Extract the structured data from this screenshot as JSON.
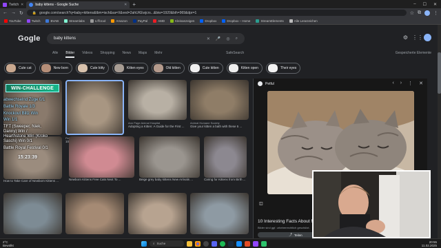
{
  "browser": {
    "tabs": [
      {
        "label": "Twitch",
        "favicon_color": "#9146ff",
        "active": false
      },
      {
        "label": "baby kittens - Google Suche",
        "favicon_color": "#4285f4",
        "active": true
      }
    ],
    "url": "google.com/search?q=baby+kittens&tbm=isch&sa=X&ved=2ahUKEwjcrs...&biw=1920&bih=969&dpr=1",
    "bookmarks": [
      {
        "label": "YouTube",
        "color": "#ff0000"
      },
      {
        "label": "Twitch",
        "color": "#9146ff"
      },
      {
        "label": "BVAB",
        "color": "#3c78d8"
      },
      {
        "label": "Streamlabs",
        "color": "#80f5d2"
      },
      {
        "label": "s.ffl.tool",
        "color": "#999999"
      },
      {
        "label": "Amazon",
        "color": "#ff9900"
      },
      {
        "label": "PayPal",
        "color": "#003087"
      },
      {
        "label": "AMD",
        "color": "#ed1c24"
      },
      {
        "label": "Kleinanzeigen",
        "color": "#86b817"
      },
      {
        "label": "Dropbox",
        "color": "#0061ff"
      },
      {
        "label": "Dropbox – Home",
        "color": "#0061ff"
      },
      {
        "label": "StreamElements",
        "color": "#2a9d8f"
      },
      {
        "label": "Alle Lesezeichen",
        "color": "#bbbbbb"
      }
    ]
  },
  "google": {
    "logo": "Google",
    "query": "baby kittens",
    "nav_tabs": [
      "Alle",
      "Bilder",
      "Videos",
      "Shopping",
      "News",
      "Maps",
      "Mehr"
    ],
    "active_tab": "Bilder",
    "safe_search": "SafeSearch",
    "collections": "Gespeicherte Elemente",
    "chips": [
      {
        "label": "Cute cat",
        "color": "#c9a88f"
      },
      {
        "label": "New born",
        "color": "#b58e78"
      },
      {
        "label": "Cute kitty",
        "color": "#d8c2ad"
      },
      {
        "label": "Kitten eyes",
        "color": "#a79c93"
      },
      {
        "label": "Old kitten",
        "color": "#b49a8c"
      },
      {
        "label": "Cute kitten",
        "color": "#f0f0f0"
      },
      {
        "label": "Kitten open",
        "color": "#eeeeee"
      },
      {
        "label": "Their eyes",
        "color": "#f2f2f2"
      }
    ],
    "results": [
      {
        "src": "",
        "caption": "",
        "color": "#8a7a6c"
      },
      {
        "src": "Petful",
        "caption": "10 Interesting Facts About Newborn ...",
        "color": "#a89682"
      },
      {
        "src": "Ann Page Animal Hospital",
        "caption": "Adopting a Kitten: A Guide for the First ...",
        "color": "#b8b0a4"
      },
      {
        "src": "Animal Humane Society",
        "caption": "Give your kitten a bath with these 5 ...",
        "color": "#8f7d67"
      },
      {
        "src": "",
        "caption": "How to Take Care of Newborn Kittens ...",
        "color": "#9b8c7e"
      },
      {
        "src": "",
        "caption": "Newborn Kittens Free Cats Next To ...",
        "color": "#d08a92"
      },
      {
        "src": "",
        "caption": "Beige grey baby kittens New Arrivals ...",
        "color": "#9a958f"
      },
      {
        "src": "",
        "caption": "Caring for Kittens from Birth ...",
        "color": "#8c8890"
      },
      {
        "src": "",
        "caption": "",
        "color": "#7d8b94"
      },
      {
        "src": "",
        "caption": "",
        "color": "#a58a74"
      },
      {
        "src": "",
        "caption": "",
        "color": "#b7a390"
      },
      {
        "src": "",
        "caption": "",
        "color": "#8e9aa3"
      }
    ],
    "panel": {
      "source": "Petful",
      "title": "10 Interesting Facts About Newborn Kittens",
      "subtitle": "Bilder sind ggf. urheberrechtlich geschützt.",
      "share_label": "Teilen"
    }
  },
  "stream_overlay": {
    "banner": "WIN-CHALLENGE",
    "lines": [
      "abwechselnd Züge 0/1",
      "Battle Royale 1/3",
      "Knockout Blitz Win",
      "Win 1/1",
      "TFT (Sweeper, Niek,",
      "Danny) Win /",
      "Hearthstone Win (Kroko",
      "Saschi) Win 0/1",
      "Battle Royal Festival 0/1"
    ],
    "timer": "15:23:39"
  },
  "taskbar": {
    "weather_temp": "2°C",
    "weather_desc": "Bewölkt",
    "search_label": "Suche",
    "time": "20:55",
    "date": "11.02.2025"
  }
}
